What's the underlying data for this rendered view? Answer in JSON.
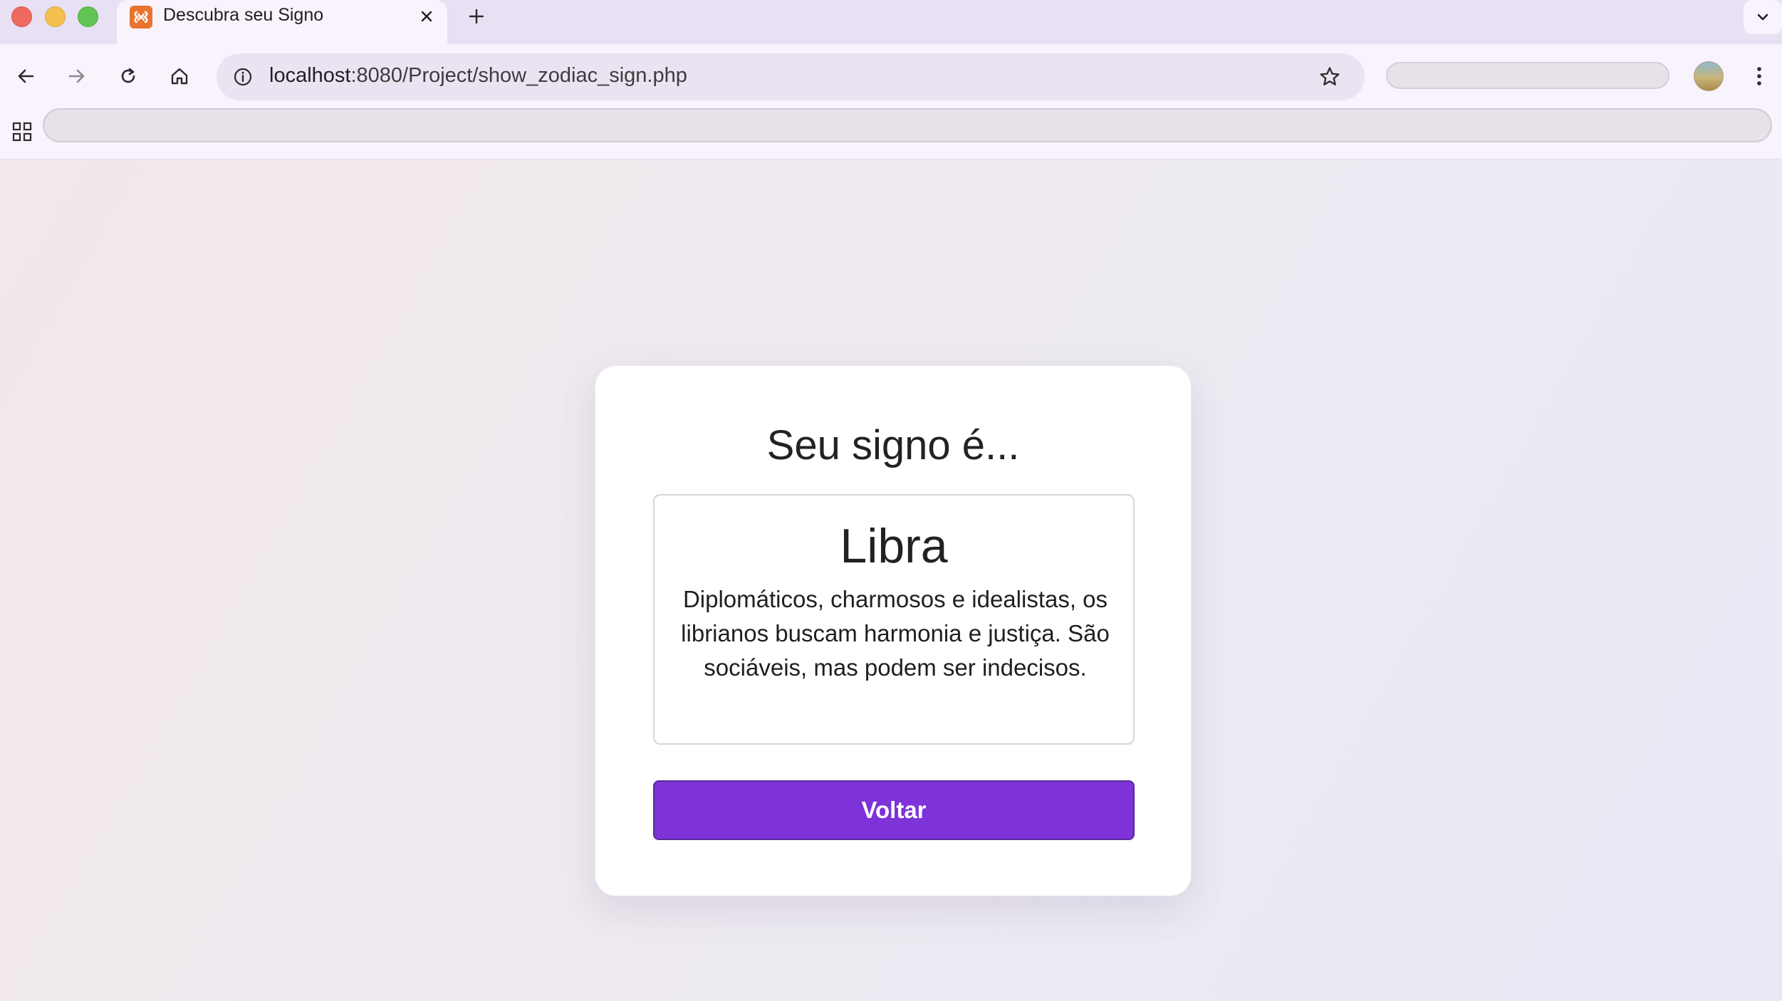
{
  "browser": {
    "tab": {
      "title": "Descubra seu Signo",
      "favicon": "xampp-icon"
    },
    "address_bar": {
      "host": "localhost",
      "rest": ":8080/Project/show_zodiac_sign.php"
    },
    "accent_color": "#e8e0f3"
  },
  "page": {
    "heading": "Seu signo é...",
    "result": {
      "sign": "Libra",
      "description": "Diplomáticos, charmosos e idealistas, os librianos buscam harmonia e justiça. São sociáveis, mas podem ser indecisos."
    },
    "back_button_label": "Voltar",
    "button_color": "#7e33d8"
  }
}
